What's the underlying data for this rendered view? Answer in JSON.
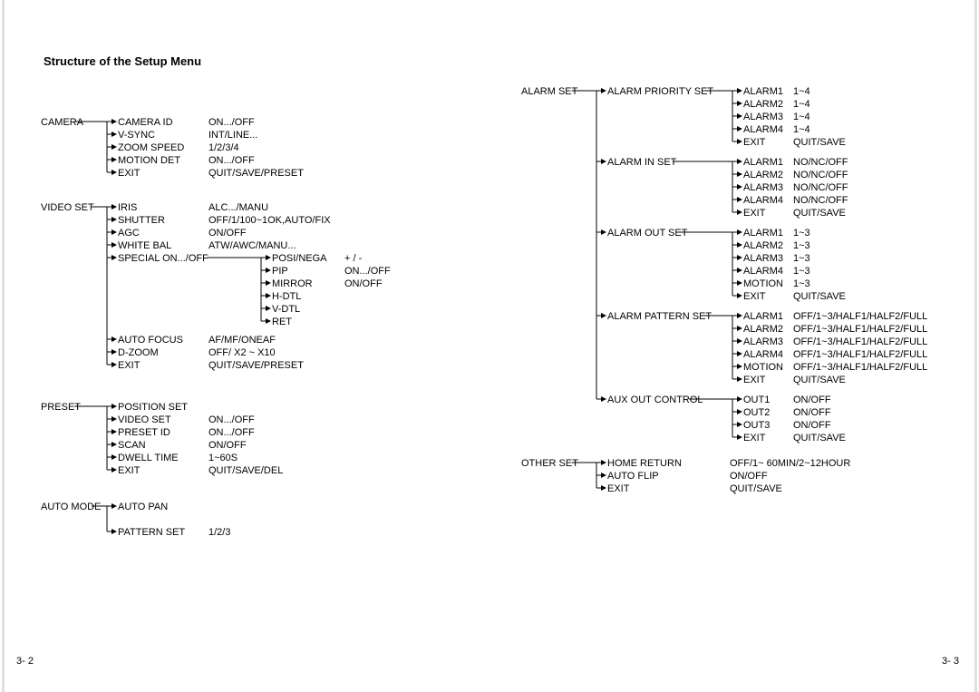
{
  "title": "Structure of the Setup Menu",
  "page_left": "3- 2",
  "page_right": "3- 3",
  "camera": {
    "heading": "CAMERA",
    "items": [
      {
        "label": "CAMERA ID",
        "value": "ON.../OFF"
      },
      {
        "label": "V-SYNC",
        "value": "INT/LINE..."
      },
      {
        "label": "ZOOM SPEED",
        "value": "1/2/3/4"
      },
      {
        "label": "MOTION DET",
        "value": "ON.../OFF"
      },
      {
        "label": "EXIT",
        "value": "QUIT/SAVE/PRESET"
      }
    ]
  },
  "videoset": {
    "heading": "VIDEO SET",
    "items_top": [
      {
        "label": "IRIS",
        "value": "ALC.../MANU"
      },
      {
        "label": "SHUTTER",
        "value": "OFF/1/100~1OK,AUTO/FIX"
      },
      {
        "label": "AGC",
        "value": "ON/OFF"
      },
      {
        "label": "WHITE BAL",
        "value": "ATW/AWC/MANU..."
      }
    ],
    "special_label": "SPECIAL ON.../OFF",
    "special_items": [
      {
        "label": "POSI/NEGA",
        "value": "+ / -"
      },
      {
        "label": "PIP",
        "value": "ON.../OFF"
      },
      {
        "label": "MIRROR",
        "value": "ON/OFF"
      },
      {
        "label": "H-DTL",
        "value": ""
      },
      {
        "label": "V-DTL",
        "value": ""
      },
      {
        "label": "RET",
        "value": ""
      }
    ],
    "items_bottom": [
      {
        "label": "AUTO FOCUS",
        "value": "AF/MF/ONEAF"
      },
      {
        "label": "D-ZOOM",
        "value": "OFF/ X2 ~ X10"
      },
      {
        "label": "EXIT",
        "value": "QUIT/SAVE/PRESET"
      }
    ]
  },
  "preset": {
    "heading": "PRESET",
    "items": [
      {
        "label": "POSITION SET",
        "value": ""
      },
      {
        "label": "VIDEO SET",
        "value": "ON.../OFF"
      },
      {
        "label": "PRESET  ID",
        "value": "ON.../OFF"
      },
      {
        "label": "SCAN",
        "value": "ON/OFF"
      },
      {
        "label": "DWELL TIME",
        "value": "1~60S"
      },
      {
        "label": "EXIT",
        "value": "QUIT/SAVE/DEL"
      }
    ]
  },
  "automode": {
    "heading": "AUTO MODE",
    "items": [
      {
        "label": "AUTO PAN",
        "value": ""
      },
      {
        "label": "PATTERN SET",
        "value": "1/2/3"
      }
    ]
  },
  "alarmset": {
    "heading": "ALARM SET",
    "groups": [
      {
        "heading": "ALARM PRIORITY SET",
        "items": [
          {
            "label": "ALARM1",
            "value": "1~4"
          },
          {
            "label": "ALARM2",
            "value": "1~4"
          },
          {
            "label": "ALARM3",
            "value": "1~4"
          },
          {
            "label": "ALARM4",
            "value": "1~4"
          },
          {
            "label": "EXIT",
            "value": "QUIT/SAVE"
          }
        ]
      },
      {
        "heading": "ALARM IN SET",
        "items": [
          {
            "label": "ALARM1",
            "value": "NO/NC/OFF"
          },
          {
            "label": "ALARM2",
            "value": "NO/NC/OFF"
          },
          {
            "label": "ALARM3",
            "value": "NO/NC/OFF"
          },
          {
            "label": "ALARM4",
            "value": "NO/NC/OFF"
          },
          {
            "label": "EXIT",
            "value": "QUIT/SAVE"
          }
        ]
      },
      {
        "heading": "ALARM OUT SET",
        "items": [
          {
            "label": "ALARM1",
            "value": "1~3"
          },
          {
            "label": "ALARM2",
            "value": "1~3"
          },
          {
            "label": "ALARM3",
            "value": "1~3"
          },
          {
            "label": "ALARM4",
            "value": "1~3"
          },
          {
            "label": "MOTION",
            "value": "1~3"
          },
          {
            "label": "EXIT",
            "value": "QUIT/SAVE"
          }
        ]
      },
      {
        "heading": "ALARM PATTERN SET",
        "items": [
          {
            "label": "ALARM1",
            "value": "OFF/1~3/HALF1/HALF2/FULL"
          },
          {
            "label": "ALARM2",
            "value": "OFF/1~3/HALF1/HALF2/FULL"
          },
          {
            "label": "ALARM3",
            "value": "OFF/1~3/HALF1/HALF2/FULL"
          },
          {
            "label": "ALARM4",
            "value": "OFF/1~3/HALF1/HALF2/FULL"
          },
          {
            "label": "MOTION",
            "value": "OFF/1~3/HALF1/HALF2/FULL"
          },
          {
            "label": "EXIT",
            "value": "QUIT/SAVE"
          }
        ]
      },
      {
        "heading": "AUX OUT CONTROL",
        "items": [
          {
            "label": "OUT1",
            "value": "ON/OFF"
          },
          {
            "label": "OUT2",
            "value": "ON/OFF"
          },
          {
            "label": "OUT3",
            "value": "ON/OFF"
          },
          {
            "label": "EXIT",
            "value": "QUIT/SAVE"
          }
        ]
      }
    ]
  },
  "otherset": {
    "heading": "OTHER SET",
    "items": [
      {
        "label": "HOME RETURN",
        "value": "OFF/1~ 60MIN/2~12HOUR"
      },
      {
        "label": "AUTO FLIP",
        "value": "ON/OFF"
      },
      {
        "label": "EXIT",
        "value": "QUIT/SAVE"
      }
    ]
  }
}
